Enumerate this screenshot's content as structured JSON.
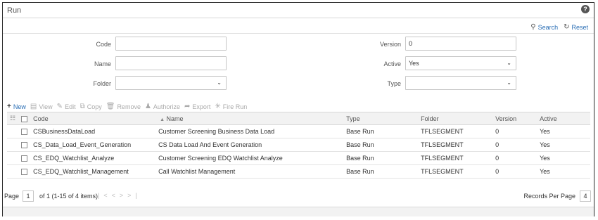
{
  "window": {
    "title": "Run",
    "help_icon": "question-circle-icon"
  },
  "search_actions": {
    "search_label": "Search",
    "reset_label": "Reset"
  },
  "form": {
    "code": {
      "label": "Code",
      "value": ""
    },
    "version": {
      "label": "Version",
      "value": "0"
    },
    "name": {
      "label": "Name",
      "value": ""
    },
    "active": {
      "label": "Active",
      "value": "Yes"
    },
    "folder": {
      "label": "Folder",
      "value": ""
    },
    "type": {
      "label": "Type",
      "value": ""
    }
  },
  "toolbar": {
    "new": "New",
    "view": "View",
    "edit": "Edit",
    "copy": "Copy",
    "remove": "Remove",
    "authorize": "Authorize",
    "export": "Export",
    "fire_run": "Fire Run"
  },
  "table": {
    "headers": {
      "code": "Code",
      "name": "Name",
      "type": "Type",
      "folder": "Folder",
      "version": "Version",
      "active": "Active"
    },
    "rows": [
      {
        "code": "CSBusinessDataLoad",
        "name": "Customer Screening Business Data Load",
        "type": "Base Run",
        "folder": "TFLSEGMENT",
        "version": "0",
        "active": "Yes"
      },
      {
        "code": "CS_Data_Load_Event_Generation",
        "name": "CS Data Load And Event Generation",
        "type": "Base Run",
        "folder": "TFLSEGMENT",
        "version": "0",
        "active": "Yes"
      },
      {
        "code": "CS_EDQ_Watchlist_Analyze",
        "name": "Customer Screening EDQ Watchlist Analyze",
        "type": "Base Run",
        "folder": "TFLSEGMENT",
        "version": "0",
        "active": "Yes"
      },
      {
        "code": "CS_EDQ_Watchlist_Management",
        "name": "Call Watchlist Management",
        "type": "Base Run",
        "folder": "TFLSEGMENT",
        "version": "0",
        "active": "Yes"
      }
    ]
  },
  "pager": {
    "page_label": "Page",
    "page_value": "1",
    "of_text": "of 1 (1-15 of 4 items)",
    "records_label": "Records Per Page",
    "records_value": "4"
  }
}
